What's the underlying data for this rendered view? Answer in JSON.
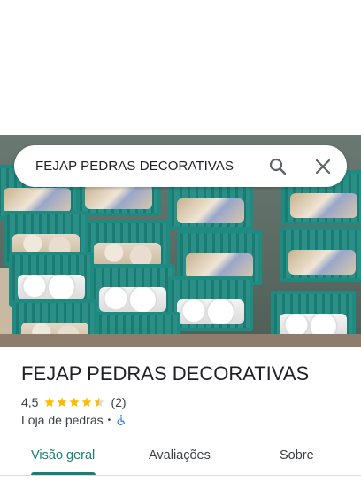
{
  "search": {
    "query": "FEJAP PEDRAS DECORATIVAS",
    "search_icon": "search-icon",
    "close_icon": "close-icon"
  },
  "hero": {
    "image_icon": "place-photo"
  },
  "place": {
    "name": "FEJAP PEDRAS DECORATIVAS",
    "rating": "4,5",
    "stars": 4.5,
    "review_count": "(2)",
    "category": "Loja de pedras",
    "separator": "•",
    "accessibility_icon": "wheelchair-accessible-icon"
  },
  "tabs": [
    {
      "label": "Visão geral",
      "active": true
    },
    {
      "label": "Avaliações",
      "active": false
    },
    {
      "label": "Sobre",
      "active": false
    }
  ],
  "colors": {
    "accent": "#1a7f73",
    "star": "#fbbc04",
    "text": "#202124",
    "secondary_text": "#3c4043",
    "accessibility_blue": "#1a73e8"
  }
}
